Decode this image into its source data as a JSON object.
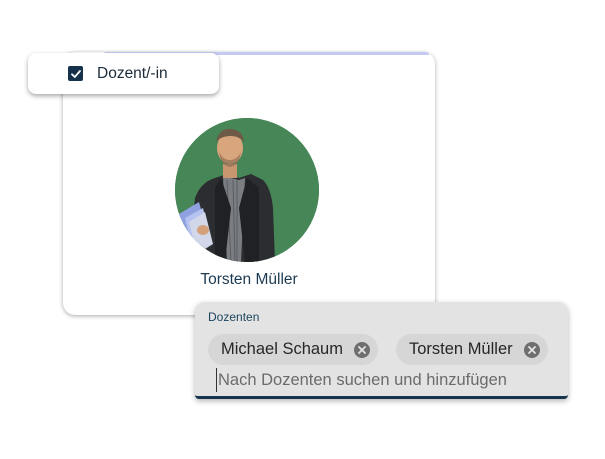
{
  "checkbox": {
    "label": "Dozent/-in",
    "checked": true
  },
  "profile": {
    "name": "Torsten Müller"
  },
  "lecturers": {
    "label": "Dozenten",
    "chips": [
      "Michael Schaum",
      "Torsten Müller"
    ],
    "placeholder": "Nach Dozenten suchen und hinzufügen"
  },
  "colors": {
    "accent": "#17344c",
    "avatar_background": "#4a8a5b",
    "field_background": "#e3e3e3",
    "chip_background": "#d6d6d6"
  },
  "icons": {
    "checkbox": "check-icon",
    "chip_remove": "close-circle-icon"
  }
}
